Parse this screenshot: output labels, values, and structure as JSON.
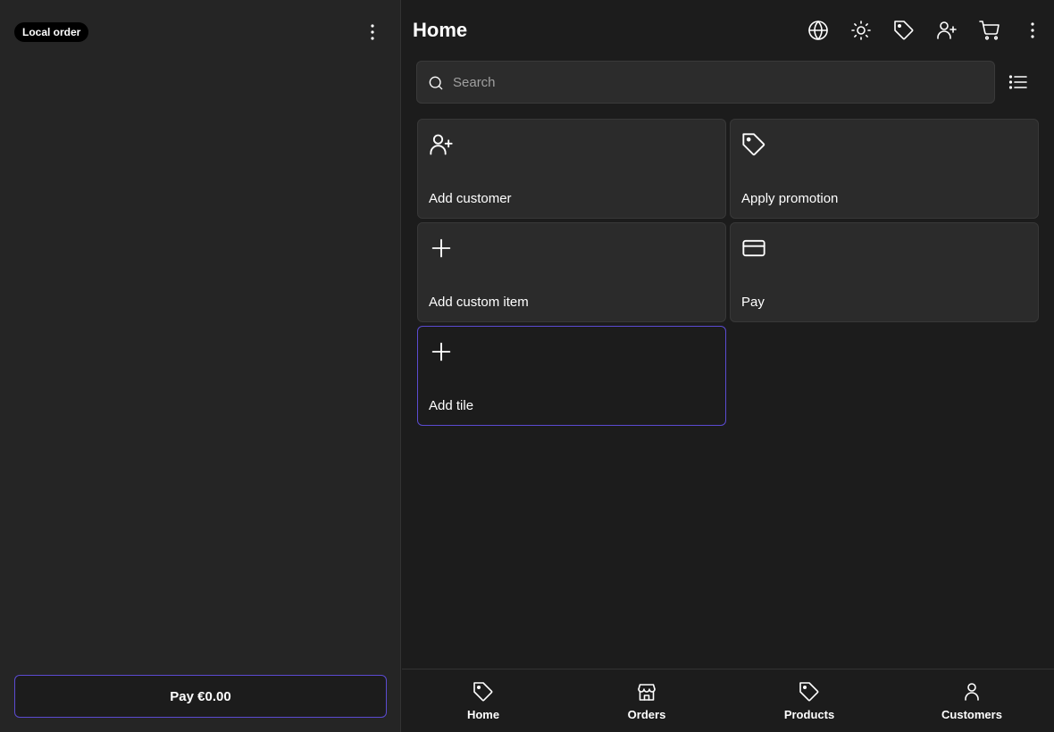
{
  "order": {
    "badge": "Local order",
    "menu_icon": "more-vertical-icon",
    "pay_button": "Pay €0.00"
  },
  "header": {
    "title": "Home",
    "icons": [
      "globe-icon",
      "sun-icon",
      "tag-icon",
      "user-plus-icon",
      "cart-icon",
      "more-vertical-icon"
    ]
  },
  "search": {
    "placeholder": "Search",
    "value": "",
    "icon": "search-icon",
    "view_toggle_icon": "list-icon"
  },
  "tiles": [
    {
      "label": "Add customer",
      "icon": "user-plus-icon"
    },
    {
      "label": "Apply promotion",
      "icon": "tag-icon"
    },
    {
      "label": "Add custom item",
      "icon": "plus-icon"
    },
    {
      "label": "Pay",
      "icon": "credit-card-icon"
    },
    {
      "label": "Add tile",
      "icon": "plus-icon"
    }
  ],
  "nav": [
    {
      "label": "Home",
      "icon": "tag-icon"
    },
    {
      "label": "Orders",
      "icon": "store-icon"
    },
    {
      "label": "Products",
      "icon": "tag-icon"
    },
    {
      "label": "Customers",
      "icon": "user-icon"
    }
  ],
  "colors": {
    "accent": "#5b4bd1",
    "background": "#1c1c1c",
    "panel": "#252525",
    "tile": "#2b2b2b"
  }
}
